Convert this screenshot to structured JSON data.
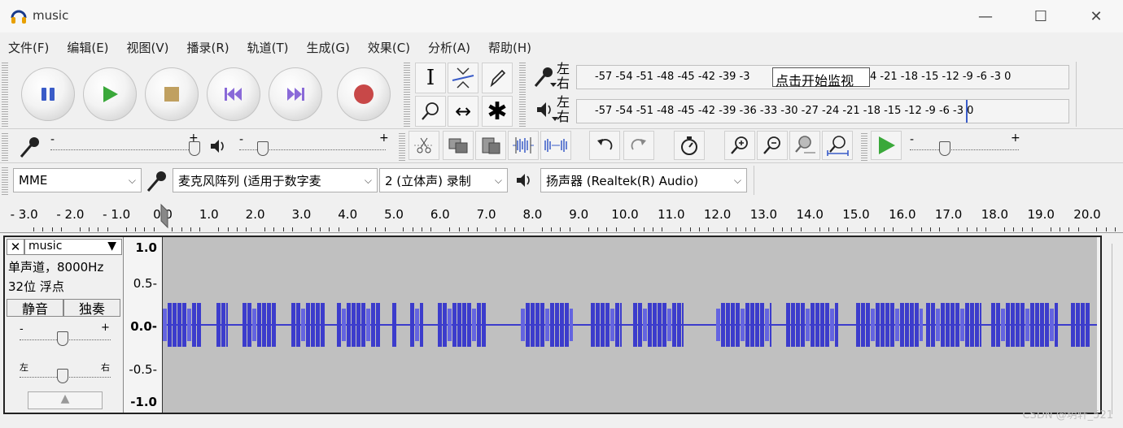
{
  "window": {
    "title": "music",
    "minimize": "—",
    "maximize": "☐",
    "close": "✕"
  },
  "menu": [
    "文件(F)",
    "编辑(E)",
    "视图(V)",
    "播录(R)",
    "轨道(T)",
    "生成(G)",
    "效果(C)",
    "分析(A)",
    "帮助(H)"
  ],
  "transport": [
    "pause",
    "play",
    "stop",
    "skip-start",
    "skip-end",
    "record"
  ],
  "tools": {
    "selection": "I",
    "multi": "✱",
    "timeshift": "↔"
  },
  "meters": {
    "rec_lr": "左\n右",
    "play_lr": "左\n右",
    "rec_ticks": "-57 -54 -51 -48 -45 -42 -39 -3",
    "rec_ticks_end": "4 -21 -18 -15 -12  -9  -6  -3  0",
    "play_ticks": "-57 -54 -51 -48 -45 -42 -39 -36 -33 -30 -27 -24 -21 -18 -15 -12  -9  -6  -3  0",
    "monitor_label": "点击开始监视"
  },
  "sliders": {
    "minus": "-",
    "plus": "+"
  },
  "devices": {
    "host": "MME",
    "input": "麦克风阵列 (适用于数字麦",
    "channels": "2 (立体声) 录制",
    "output": "扬声器 (Realtek(R) Audio)"
  },
  "timeline": [
    "- 3.0",
    "- 2.0",
    "- 1.0",
    "0.0",
    "1.0",
    "2.0",
    "3.0",
    "4.0",
    "5.0",
    "6.0",
    "7.0",
    "8.0",
    "9.0",
    "10.0",
    "11.0",
    "12.0",
    "13.0",
    "14.0",
    "15.0",
    "16.0",
    "17.0",
    "18.0",
    "19.0",
    "20.0"
  ],
  "track": {
    "name": "music",
    "close": "✕",
    "menu_arrow": "▼",
    "info_line1": "单声道，8000Hz",
    "info_line2": "32位 浮点",
    "mute": "静音",
    "solo": "独奏",
    "gain_minus": "-",
    "gain_plus": "+",
    "pan_left": "左",
    "pan_right": "右",
    "collapse": "▲",
    "scale": [
      "1.0",
      "0.5-",
      "0.0-",
      "-0.5-",
      "-1.0"
    ]
  },
  "colors": {
    "waveform": "#3c3ccc",
    "waveform_light": "#6464e0",
    "record": "#c04040",
    "play": "#2f9a2f"
  },
  "watermark": "CSDN @玥轩_521"
}
